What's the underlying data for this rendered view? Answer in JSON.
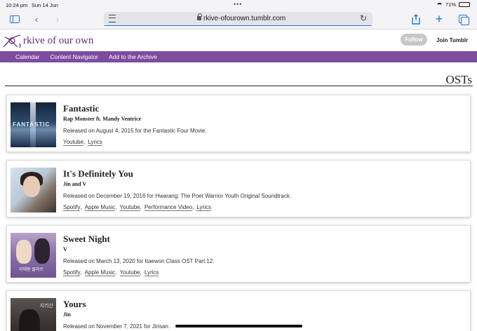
{
  "status_bar": {
    "time": "10:24 pm",
    "date": "Sun 14 Jun",
    "battery": "71%",
    "battery_level": 0.71
  },
  "browser": {
    "url": "rkive-ofourown.tumblr.com"
  },
  "site": {
    "title": "rkive of our own",
    "follow_label": "Follow",
    "join_label": "Join Tumblr",
    "accent_color": "#7d4c9f",
    "title_color": "#5d2f7f"
  },
  "nav": {
    "items": [
      {
        "label": "Calendar"
      },
      {
        "label": "Content Navigator"
      },
      {
        "label": "Add to the Archive"
      }
    ]
  },
  "page": {
    "heading": "OSTs"
  },
  "osts": [
    {
      "title": "Fantastic",
      "artist": "Rap Monster ft. Mandy Ventrice",
      "release": "Released on August 4, 2015 for the Fantastic Four Movie.",
      "cover_text": "FANTASTIC",
      "links": [
        "Youtube",
        "Lyrics"
      ]
    },
    {
      "title": "It's Definitely You",
      "artist": "Jin and V",
      "release": "Released on December 19, 2016 for Hwarang: The Poet Warrior Youth Original Soundtrack.",
      "links": [
        "Spotify",
        "Apple Music",
        "Youtube",
        "Performance Video",
        "Lyrics"
      ]
    },
    {
      "title": "Sweet Night",
      "artist": "V",
      "release": "Released on March 13, 2020 for Itaewon Class OST Part.12.",
      "cover_text": "이태원 클라쓰",
      "links": [
        "Spotify",
        "Apple Music",
        "Youtube",
        "Lyrics"
      ]
    },
    {
      "title": "Yours",
      "artist": "Jin",
      "release": "Released on November 7, 2021 for Jirisan.",
      "cover_text": "지리산",
      "links": []
    }
  ]
}
